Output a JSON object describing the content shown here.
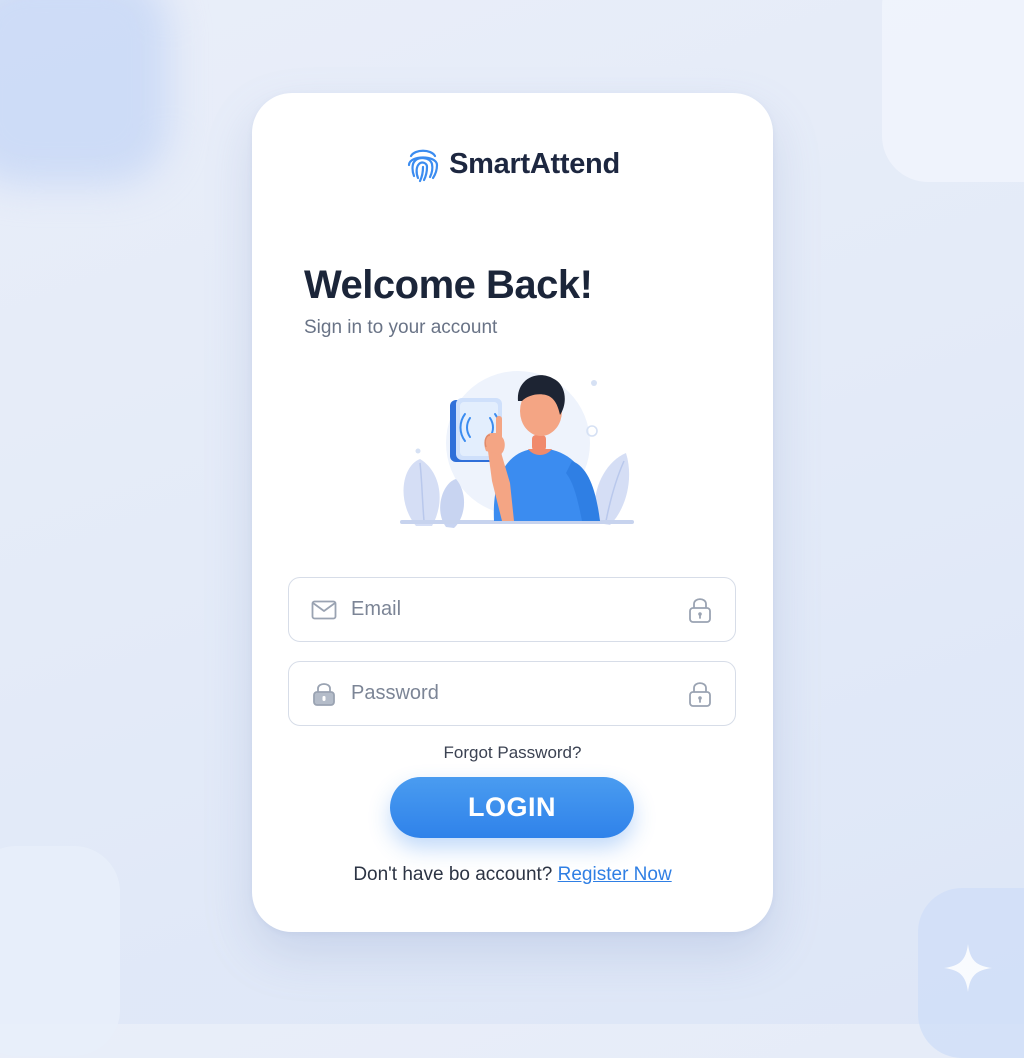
{
  "brand": {
    "name": "SmartAttend",
    "logo_icon": "fingerprint-icon",
    "accent_color": "#2f82ea"
  },
  "header": {
    "title": "Welcome Back!",
    "subtitle": "Sign in to your account"
  },
  "illustration": {
    "icon": "fingerprint-scan-illustration"
  },
  "form": {
    "email": {
      "value": "",
      "placeholder": "Email",
      "lead_icon": "mail-icon",
      "trail_icon": "lock-icon"
    },
    "password": {
      "value": "",
      "placeholder": "Password",
      "lead_icon": "lock-icon",
      "trail_icon": "lock-icon"
    },
    "forgot_label": "Forgot Password?",
    "login_label": "LOGIN"
  },
  "footer": {
    "register_prompt": "Don't have bo account?",
    "register_link": "Register Now"
  },
  "decor": {
    "corner_icon": "sparkle-icon"
  }
}
